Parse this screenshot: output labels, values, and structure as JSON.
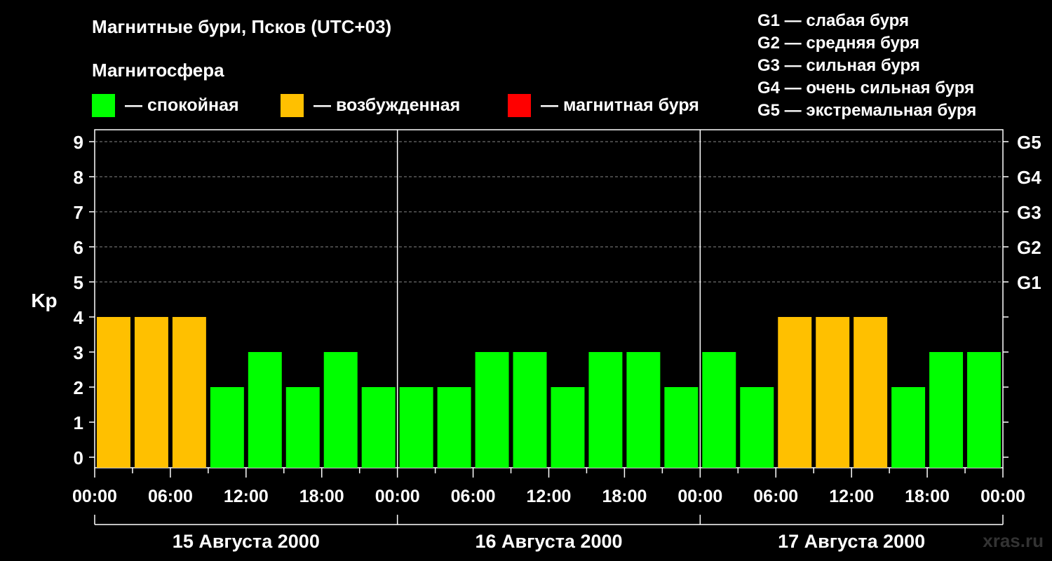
{
  "title": "Магнитные бури, Псков (UTC+03)",
  "subtitle": "Магнитосфера",
  "legend": [
    {
      "label": "— спокойная",
      "color": "#00ff00"
    },
    {
      "label": "— возбужденная",
      "color": "#ffc000"
    },
    {
      "label": "— магнитная буря",
      "color": "#ff0000"
    }
  ],
  "g_legend": [
    "G1 — слабая буря",
    "G2 — средняя буря",
    "G3 — сильная буря",
    "G4 — очень сильная буря",
    "G5 — экстремальная буря"
  ],
  "watermark": "xras.ru",
  "chart_data": {
    "type": "bar",
    "ylabel": "Kp",
    "ylim": [
      0,
      9
    ],
    "y_ticks": [
      0,
      1,
      2,
      3,
      4,
      5,
      6,
      7,
      8,
      9
    ],
    "g_ticks": [
      {
        "value": 5,
        "label": "G1"
      },
      {
        "value": 6,
        "label": "G2"
      },
      {
        "value": 7,
        "label": "G3"
      },
      {
        "value": 8,
        "label": "G4"
      },
      {
        "value": 9,
        "label": "G5"
      }
    ],
    "x_tick_labels": [
      "00:00",
      "06:00",
      "12:00",
      "18:00",
      "00:00",
      "06:00",
      "12:00",
      "18:00",
      "00:00",
      "06:00",
      "12:00",
      "18:00",
      "00:00"
    ],
    "days": [
      "15 Августа 2000",
      "16 Августа 2000",
      "17 Августа 2000"
    ],
    "values": [
      4,
      4,
      4,
      2,
      3,
      2,
      3,
      2,
      2,
      2,
      3,
      3,
      2,
      3,
      3,
      2,
      3,
      2,
      4,
      4,
      4,
      2,
      3,
      3
    ],
    "colors": {
      "quiet": "#00ff00",
      "active": "#ffc000",
      "storm": "#ff0000"
    },
    "grid": true
  }
}
